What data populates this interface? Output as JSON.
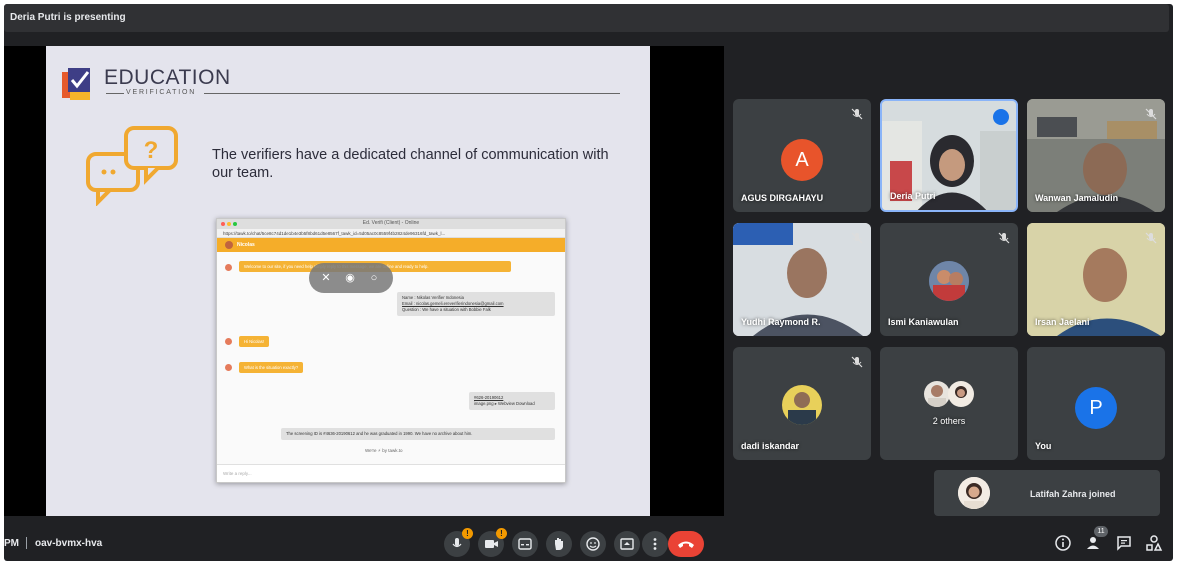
{
  "presenting": {
    "text": "Deria Putri is presenting"
  },
  "slide": {
    "brand_title": "EDUCATION",
    "brand_subtitle": "VERIFICATION",
    "text": "The verifiers have a dedicated channel of communication with our team.",
    "screenshot": {
      "window_title": "Ed. Verifi (Client) - Online",
      "url": "https://tawk.to/chat/5ce8c74d1de1b4e3b5f8bd61d5e8567f_tawk_id=5d05ac0c8559f4b2824de96316fd_tawk_l...",
      "agent_name": "Nicolas",
      "msg_welcome": "Welcome to our site, if you need help simply reply to this message, we are online and ready to help.",
      "info_lines": [
        "Name : Nikolas Verifier Indonesia",
        "Email : nicolas.gemeli.ereverifierindonesia@gmail.com",
        "Question : We have a situation with Bobbie Falk"
      ],
      "msg_hi": "Hi Nicolas!",
      "msg_question": "What is the situation exactly?",
      "file_lines": [
        "#626-20190612",
        "image.png ▸ Webview  Download"
      ],
      "msg_answer": "The screening ID is #4636-20190612 and he was graduated in 1990. We have no archive about him.",
      "powered": "We're ⚡ by tawk.to",
      "input_placeholder": "Write a reply..."
    }
  },
  "participants": [
    {
      "name": "AGUS DIRGAHAYU",
      "initial": "A",
      "avatar_color": "#e8542b",
      "muted": true
    },
    {
      "name": "Deria Putri",
      "speaking": true
    },
    {
      "name": "Wanwan Jamaludin",
      "muted": true
    },
    {
      "name": "Yudhi Raymond R.",
      "muted": true
    },
    {
      "name": "Ismi Kaniawulan",
      "muted": true
    },
    {
      "name": "Irsan Jaelani",
      "muted": true
    },
    {
      "name": "dadi iskandar",
      "muted": true
    },
    {
      "name": "2 others"
    },
    {
      "name": "You",
      "initial": "P",
      "avatar_color": "#1a73e8"
    }
  ],
  "toast": {
    "text": "Latifah Zahra joined"
  },
  "bottom": {
    "clock": "PM",
    "meeting_code": "oav-bvmx-hva",
    "people_count": "11",
    "warn_symbol": "!"
  },
  "colors": {
    "accent_orange": "#f5ad29",
    "end_call": "#ea4335",
    "tile_bg": "#3c4043"
  }
}
